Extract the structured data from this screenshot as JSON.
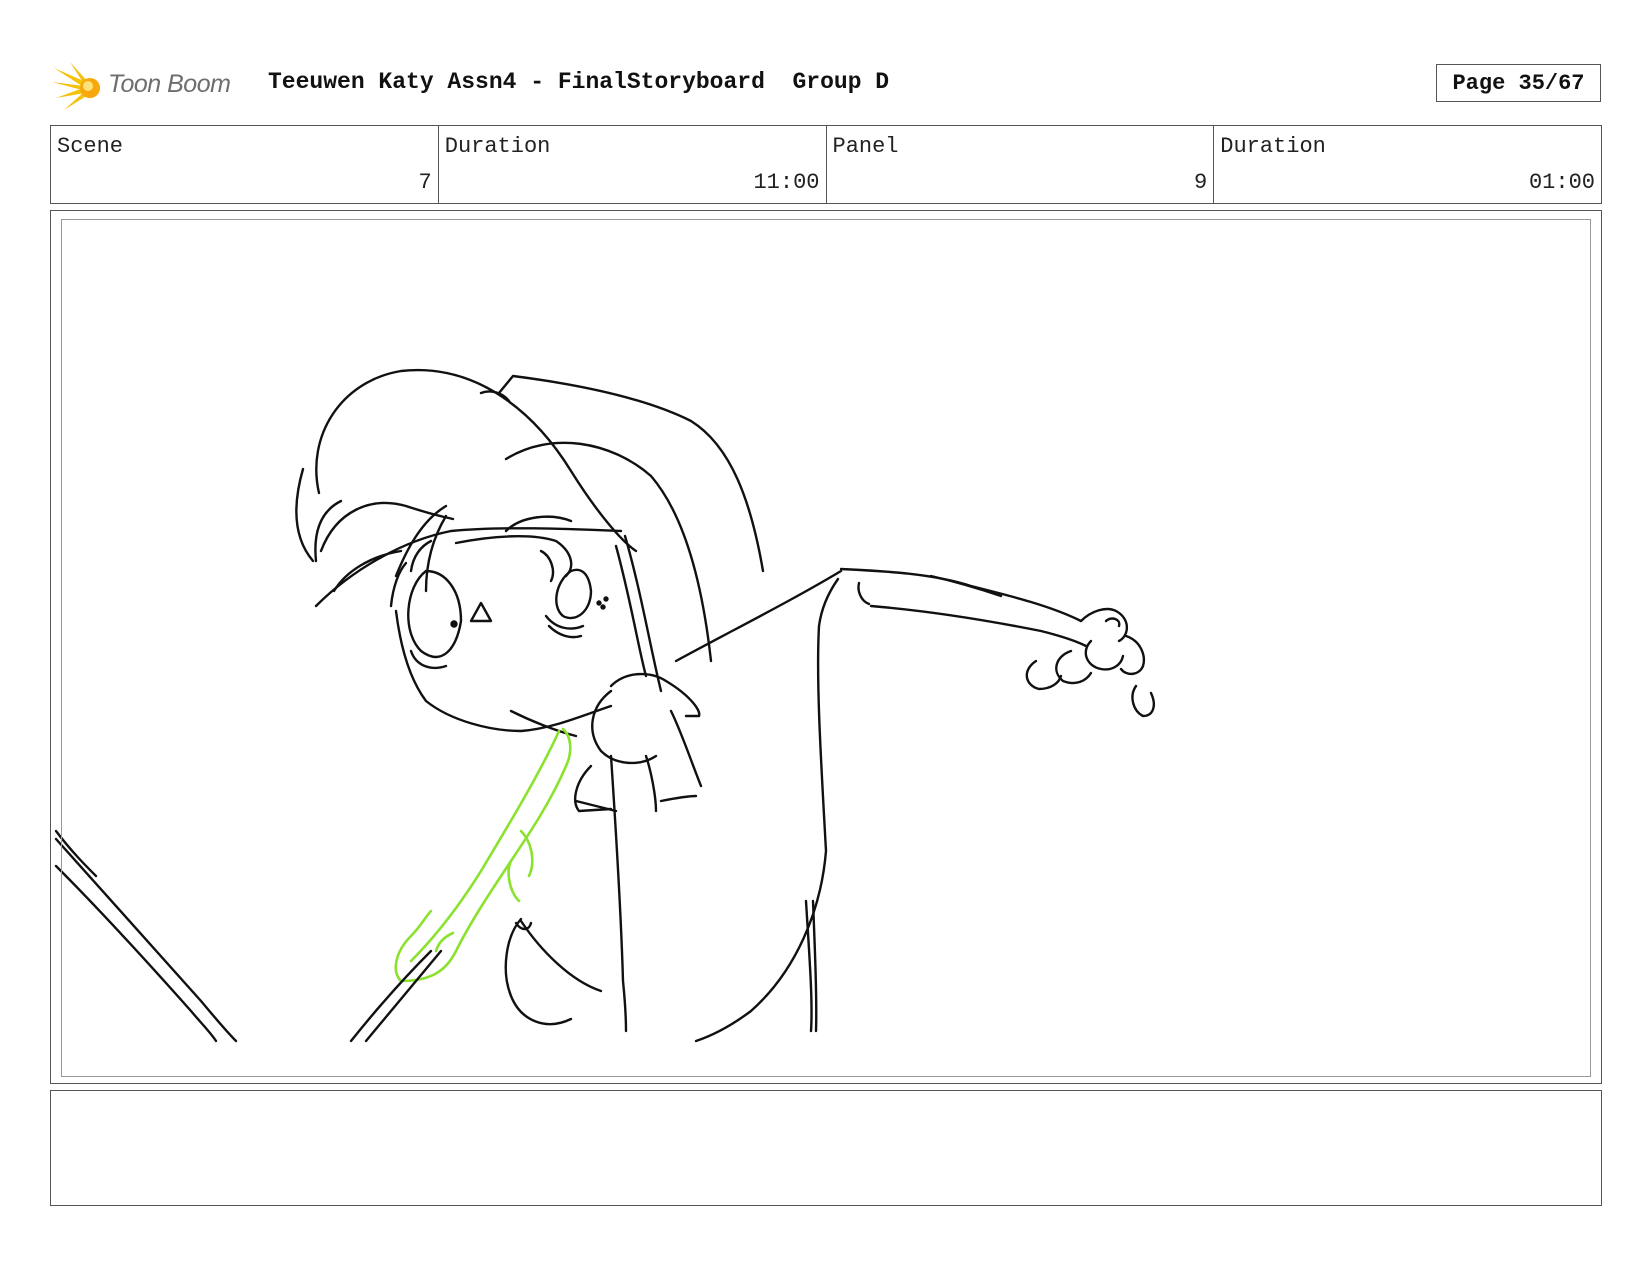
{
  "header": {
    "brand": "Toon Boom",
    "title": "Teeuwen Katy Assn4 - FinalStoryboard  Group D",
    "page": "Page 35/67"
  },
  "info": {
    "scene_label": "Scene",
    "scene_value": "7",
    "scene_duration_label": "Duration",
    "scene_duration_value": "11:00",
    "panel_label": "Panel",
    "panel_value": "9",
    "panel_duration_label": "Duration",
    "panel_duration_value": "01:00"
  },
  "notes": {
    "text": ""
  },
  "colors": {
    "line": "#111111",
    "accent_green": "#8be22e",
    "logo_yellow": "#f4c20d"
  }
}
